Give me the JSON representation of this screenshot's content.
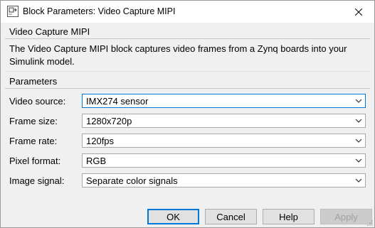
{
  "window": {
    "title": "Block Parameters: Video Capture MIPI"
  },
  "block": {
    "name": "Video Capture MIPI",
    "description_line1": "The Video Capture MIPI block captures video frames from a  Zynq boards into your",
    "description_line2": "Simulink model."
  },
  "parameters": {
    "heading": "Parameters",
    "rows": [
      {
        "label": "Video source:",
        "value": "IMX274 sensor"
      },
      {
        "label": "Frame size:",
        "value": "1280x720p"
      },
      {
        "label": "Frame rate:",
        "value": "120fps"
      },
      {
        "label": "Pixel format:",
        "value": "RGB"
      },
      {
        "label": "Image signal:",
        "value": "Separate color signals"
      }
    ]
  },
  "buttons": {
    "ok": "OK",
    "cancel": "Cancel",
    "help": "Help",
    "apply": "Apply"
  },
  "colors": {
    "accent": "#0078d7",
    "dialog_bg": "#f0f0f0",
    "titlebar_bg": "#ffffff"
  },
  "icons": [
    "simulink-block-icon",
    "close-icon",
    "chevron-down-icon",
    "resize-grip-icon"
  ]
}
